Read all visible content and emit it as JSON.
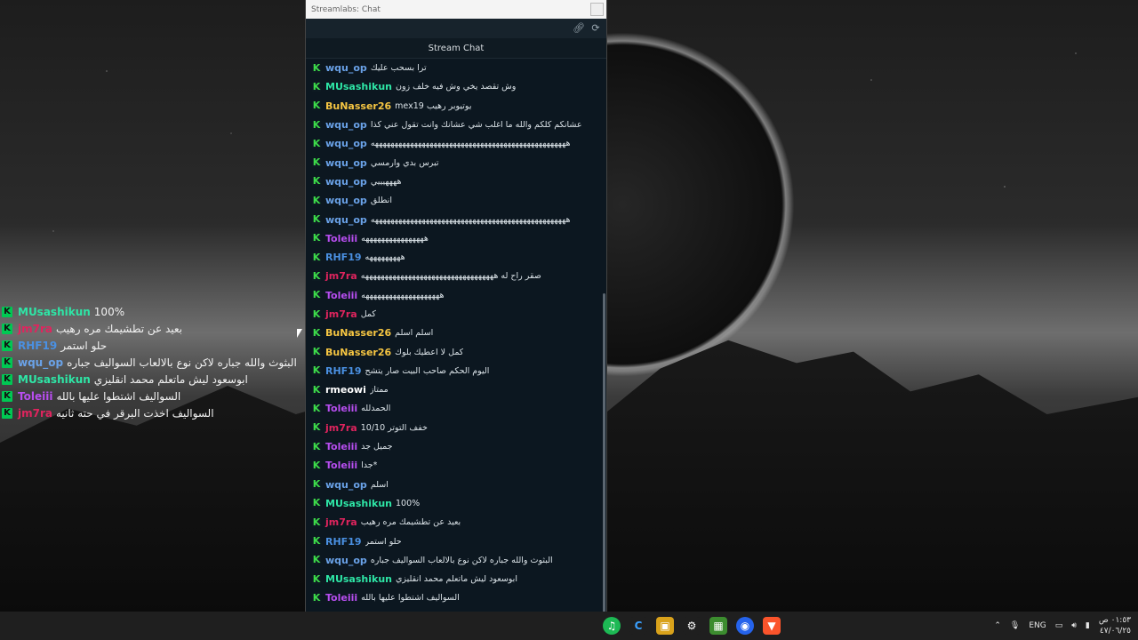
{
  "window": {
    "title": "Streamlabs: Chat",
    "tab_label": "Stream Chat"
  },
  "overlay_chat": [
    {
      "nick": "MUsashikun",
      "color": "#2ee6a6",
      "text": "100%"
    },
    {
      "nick": "jm7ra",
      "color": "#e0245e",
      "text": "بعيد عن تطشيمك مره رهيب"
    },
    {
      "nick": "RHF19",
      "color": "#4a90e2",
      "text": "حلو استمر"
    },
    {
      "nick": "wqu_op",
      "color": "#6aa2e8",
      "text": "البثوث والله جباره لاكن نوع بالالعاب السواليف جباره"
    },
    {
      "nick": "MUsashikun",
      "color": "#2ee6a6",
      "text": "ابوسعود ليش ماتعلم محمد انقليزي"
    },
    {
      "nick": "Toleiii",
      "color": "#b84ef0",
      "text": "السواليف اشتطوا عليها بالله"
    },
    {
      "nick": "jm7ra",
      "color": "#e0245e",
      "text": "السواليف اخذت البرقر في حته ثانيه"
    }
  ],
  "messages": [
    {
      "nick": "wqu_op",
      "color": "#6aa2e8",
      "text": "ترا بسحب عليك"
    },
    {
      "nick": "MUsashikun",
      "color": "#2ee6a6",
      "text": "وش تقصد يخي وش فيه خلف زون"
    },
    {
      "nick": "BuNasser26",
      "color": "#f5c542",
      "text": "mex19 يوتيوبر رهيب"
    },
    {
      "nick": "wqu_op",
      "color": "#6aa2e8",
      "text": "عشانكم كلكم والله ما اغلب شي عشانك وانت تقول عني كذا"
    },
    {
      "nick": "wqu_op",
      "color": "#6aa2e8",
      "text": "ههههههههههههههههههههههههههههههههههههههههههههههههههه"
    },
    {
      "nick": "wqu_op",
      "color": "#6aa2e8",
      "text": "تبرس بدي وارمسي"
    },
    {
      "nick": "wqu_op",
      "color": "#6aa2e8",
      "text": "ههههيييي"
    },
    {
      "nick": "wqu_op",
      "color": "#6aa2e8",
      "text": "انطلق"
    },
    {
      "nick": "wqu_op",
      "color": "#6aa2e8",
      "text": "ههههههههههههههههههههههههههههههههههههههههههههههههههه"
    },
    {
      "nick": "Toleiii",
      "color": "#b84ef0",
      "text": "ههههههههههههههههه"
    },
    {
      "nick": "RHF19",
      "color": "#4a90e2",
      "text": "هههههههههه"
    },
    {
      "nick": "jm7ra",
      "color": "#e0245e",
      "text": "صقر راح له ههههههههههههههههههههههههههههههههههه"
    },
    {
      "nick": "Toleiii",
      "color": "#b84ef0",
      "text": "ههههههههههههههههههههه"
    },
    {
      "nick": "jm7ra",
      "color": "#e0245e",
      "text": "كمل"
    },
    {
      "nick": "BuNasser26",
      "color": "#f5c542",
      "text": "اسلم اسلم"
    },
    {
      "nick": "BuNasser26",
      "color": "#f5c542",
      "text": "كمل لا اعطيك بلوك"
    },
    {
      "nick": "RHF19",
      "color": "#4a90e2",
      "text": "اليوم الحكم صاحب البيت صار يتشح"
    },
    {
      "nick": "rmeowi",
      "color": "#ffffff",
      "text": "ممتاز"
    },
    {
      "nick": "Toleiii",
      "color": "#b84ef0",
      "text": "الحمدلله"
    },
    {
      "nick": "jm7ra",
      "color": "#e0245e",
      "text": "10/10 خفف التوتر"
    },
    {
      "nick": "Toleiii",
      "color": "#b84ef0",
      "text": "جميل جد"
    },
    {
      "nick": "Toleiii",
      "color": "#b84ef0",
      "text": "جدا*"
    },
    {
      "nick": "wqu_op",
      "color": "#6aa2e8",
      "text": "اسلم"
    },
    {
      "nick": "MUsashikun",
      "color": "#2ee6a6",
      "text": "100%"
    },
    {
      "nick": "jm7ra",
      "color": "#e0245e",
      "text": "بعيد عن تطشيمك مره رهيب"
    },
    {
      "nick": "RHF19",
      "color": "#4a90e2",
      "text": "حلو استمر"
    },
    {
      "nick": "wqu_op",
      "color": "#6aa2e8",
      "text": "البثوث والله جباره لاكن نوع بالالعاب السواليف جباره"
    },
    {
      "nick": "MUsashikun",
      "color": "#2ee6a6",
      "text": "ابوسعود ليش ماتعلم محمد انقليزي"
    },
    {
      "nick": "Toleiii",
      "color": "#b84ef0",
      "text": "السواليف اشتطوا عليها بالله"
    },
    {
      "nick": "jm7ra",
      "color": "#e0245e",
      "text": "السواليف اخذت البرقر في حته ثانيه"
    }
  ],
  "taskbar": {
    "language": "ENG",
    "time": "٠١:٥٣ ص",
    "date": "٤٧/٠٦/٢٥"
  }
}
